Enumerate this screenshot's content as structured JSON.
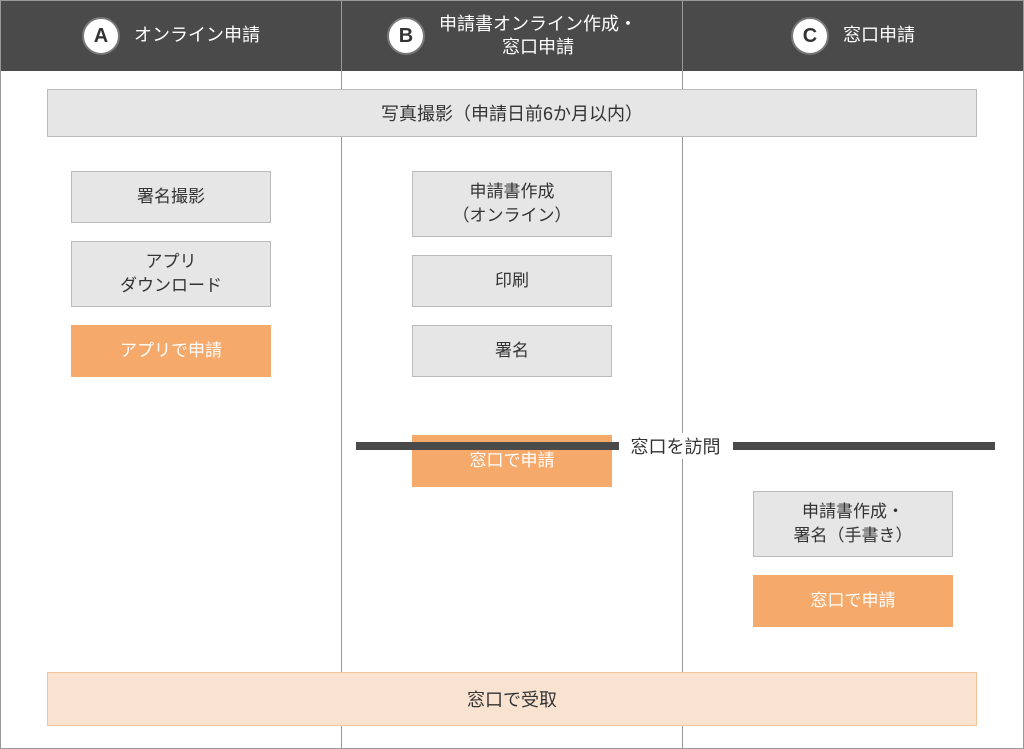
{
  "header": {
    "columns": [
      {
        "badge": "A",
        "label": "オンライン申請"
      },
      {
        "badge": "B",
        "label": "申請書オンライン作成・\n窓口申請"
      },
      {
        "badge": "C",
        "label": "窓口申請"
      }
    ]
  },
  "photo_bar": "写真撮影（申請日前6か月以内）",
  "col_a": {
    "steps": [
      "署名撮影",
      "アプリ\nダウンロード"
    ],
    "final": "アプリで申請"
  },
  "col_b": {
    "steps": [
      "申請書作成\n（オンライン）",
      "印刷",
      "署名"
    ],
    "final": "窓口で申請"
  },
  "visit_label": "窓口を訪問",
  "col_c": {
    "step": "申請書作成・\n署名（手書き）",
    "final": "窓口で申請"
  },
  "pickup_bar": "窓口で受取"
}
